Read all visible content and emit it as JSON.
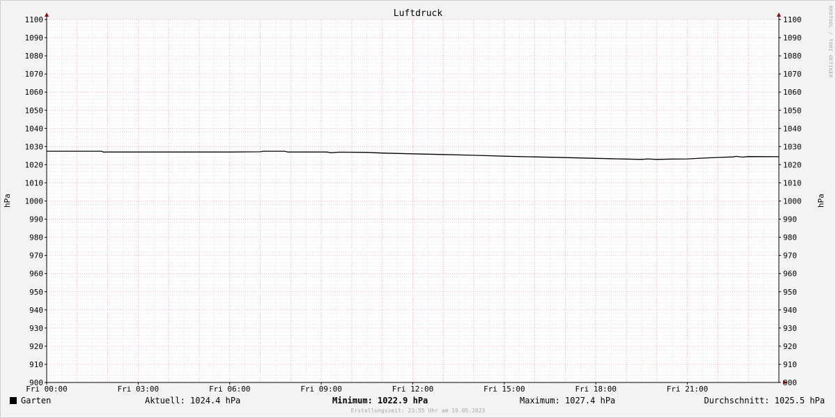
{
  "chart_data": {
    "type": "line",
    "title": "Luftdruck",
    "ylabel": "hPa",
    "ylim": [
      900,
      1100
    ],
    "y_ticks": [
      900,
      910,
      920,
      930,
      940,
      950,
      960,
      970,
      980,
      990,
      1000,
      1010,
      1020,
      1030,
      1040,
      1050,
      1060,
      1070,
      1080,
      1090,
      1100
    ],
    "xlim_hours": [
      0,
      24
    ],
    "x_ticks": [
      {
        "hour": 0,
        "label": "Fri 00:00"
      },
      {
        "hour": 3,
        "label": "Fri 03:00"
      },
      {
        "hour": 6,
        "label": "Fri 06:00"
      },
      {
        "hour": 9,
        "label": "Fri 09:00"
      },
      {
        "hour": 12,
        "label": "Fri 12:00"
      },
      {
        "hour": 15,
        "label": "Fri 15:00"
      },
      {
        "hour": 18,
        "label": "Fri 18:00"
      },
      {
        "hour": 21,
        "label": "Fri 21:00"
      }
    ],
    "grid": true,
    "series": [
      {
        "name": "Garten",
        "color": "#000000",
        "points": [
          [
            0,
            1027.4
          ],
          [
            1.8,
            1027.4
          ],
          [
            1.85,
            1027.0
          ],
          [
            3,
            1027.0
          ],
          [
            6,
            1027.0
          ],
          [
            7,
            1027.1
          ],
          [
            7.1,
            1027.4
          ],
          [
            7.8,
            1027.4
          ],
          [
            7.9,
            1027.0
          ],
          [
            9.2,
            1027.0
          ],
          [
            9.3,
            1026.6
          ],
          [
            9.6,
            1026.9
          ],
          [
            10.5,
            1026.8
          ],
          [
            11,
            1026.4
          ],
          [
            12,
            1026.0
          ],
          [
            13,
            1025.6
          ],
          [
            14,
            1025.2
          ],
          [
            15,
            1024.7
          ],
          [
            16,
            1024.3
          ],
          [
            17,
            1023.9
          ],
          [
            18,
            1023.5
          ],
          [
            18.5,
            1023.3
          ],
          [
            19,
            1023.1
          ],
          [
            19.5,
            1022.9
          ],
          [
            19.7,
            1023.2
          ],
          [
            20,
            1022.9
          ],
          [
            20.5,
            1023.1
          ],
          [
            21,
            1023.2
          ],
          [
            21.5,
            1023.6
          ],
          [
            22,
            1024.0
          ],
          [
            22.5,
            1024.3
          ],
          [
            22.6,
            1024.6
          ],
          [
            22.8,
            1024.2
          ],
          [
            23,
            1024.5
          ],
          [
            24,
            1024.4
          ]
        ]
      }
    ]
  },
  "watermark": "RRDTOOL / TOBI OETIKER",
  "legend": {
    "series_name": "Garten",
    "aktuell": "Aktuell: 1024.4 hPa",
    "minimum_label": "Minimum:",
    "minimum_value": "1022.9 hPa",
    "maximum": "Maximum: 1027.4 hPa",
    "durchschnitt": "Durchschnitt: 1025.5 hPa"
  },
  "footer": "Erstellungszeit: 23:55 Uhr am 19.05.2023",
  "colors": {
    "background": "#f3f3f3",
    "plot_background": "#ffffff",
    "major_grid": "#f0a0a0",
    "minor_grid": "#d8d8d8",
    "line": "#000000",
    "arrow": "#a00000"
  }
}
